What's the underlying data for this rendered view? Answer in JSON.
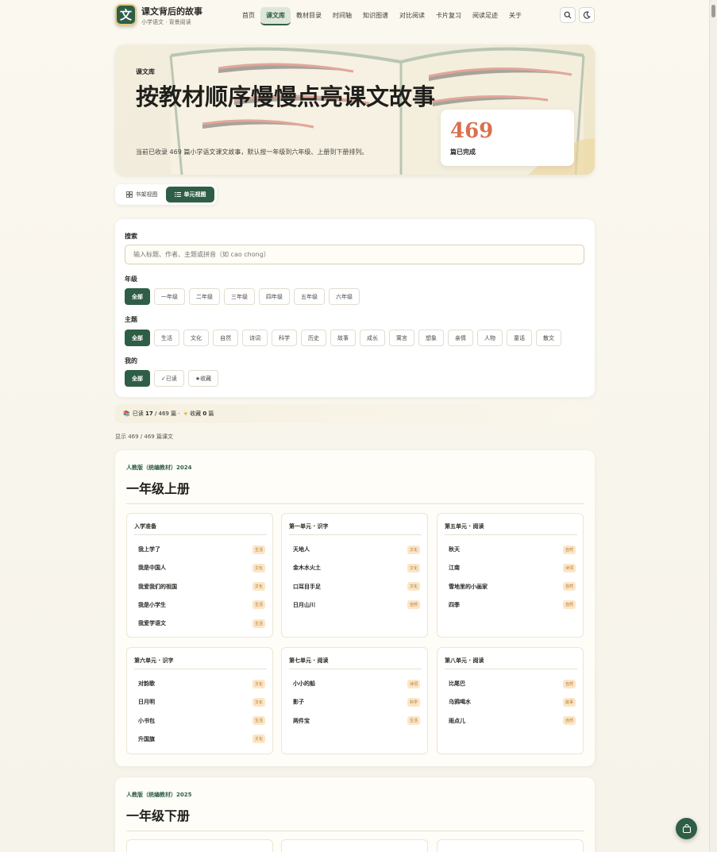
{
  "brand": {
    "logo_char": "文",
    "title": "课文背后的故事",
    "subtitle": "小学语文 · 背景阅读"
  },
  "nav": [
    "首页",
    "课文库",
    "教材目录",
    "时间轴",
    "知识图谱",
    "对比阅读",
    "卡片复习",
    "阅读足迹",
    "关于"
  ],
  "nav_active": 1,
  "hero": {
    "kicker": "课文库",
    "title": "按教材顺序慢慢点亮课文故事",
    "desc": "当前已收录 469 篇小学语文课文故事，默认按一年级到六年级、上册到下册排列。",
    "stat_value": "469",
    "stat_label": "篇已完成"
  },
  "view_toggle": {
    "shelf": "书架视图",
    "unit": "单元视图"
  },
  "filters": {
    "search_label": "搜索",
    "search_placeholder": "输入标题、作者、主题或拼音（如 cao chong）",
    "grade_label": "年级",
    "grades": [
      "全部",
      "一年级",
      "二年级",
      "三年级",
      "四年级",
      "五年级",
      "六年级"
    ],
    "theme_label": "主题",
    "themes": [
      "全部",
      "生活",
      "文化",
      "自然",
      "诗词",
      "科学",
      "历史",
      "故事",
      "成长",
      "寓言",
      "想象",
      "亲情",
      "人物",
      "童话",
      "散文"
    ],
    "mine_label": "我的",
    "mine": [
      "全部",
      "✓已读",
      "★收藏"
    ]
  },
  "status": {
    "read_prefix": "已读",
    "read_count": "17",
    "read_suffix": "/ 469 篇 ·",
    "fav_prefix": "收藏",
    "fav_count": "0",
    "fav_suffix": "篇"
  },
  "showing": "显示 469 / 469 篇课文",
  "grades_sections": [
    {
      "edition": "人教版（统编教材）2024",
      "title": "一年级上册",
      "units": [
        {
          "title": "入学准备",
          "lessons": [
            {
              "name": "我上学了",
              "tag": "生活"
            },
            {
              "name": "我是中国人",
              "tag": "文化"
            },
            {
              "name": "我爱我们的祖国",
              "tag": "文化"
            },
            {
              "name": "我是小学生",
              "tag": "生活"
            },
            {
              "name": "我爱学语文",
              "tag": "生活"
            }
          ]
        },
        {
          "title": "第一单元 · 识字",
          "lessons": [
            {
              "name": "天地人",
              "tag": "文化"
            },
            {
              "name": "金木水火土",
              "tag": "文化"
            },
            {
              "name": "口耳目手足",
              "tag": "文化"
            },
            {
              "name": "日月山川",
              "tag": "自然"
            }
          ]
        },
        {
          "title": "第五单元 · 阅读",
          "lessons": [
            {
              "name": "秋天",
              "tag": "自然"
            },
            {
              "name": "江南",
              "tag": "诗词"
            },
            {
              "name": "雪地里的小画家",
              "tag": "自然"
            },
            {
              "name": "四季",
              "tag": "自然"
            }
          ]
        },
        {
          "title": "第六单元 · 识字",
          "lessons": [
            {
              "name": "对韵歌",
              "tag": "文化"
            },
            {
              "name": "日月明",
              "tag": "文化"
            },
            {
              "name": "小书包",
              "tag": "生活"
            },
            {
              "name": "升国旗",
              "tag": "文化"
            }
          ]
        },
        {
          "title": "第七单元 · 阅读",
          "lessons": [
            {
              "name": "小小的船",
              "tag": "诗词"
            },
            {
              "name": "影子",
              "tag": "科学"
            },
            {
              "name": "两件宝",
              "tag": "生活"
            }
          ]
        },
        {
          "title": "第八单元 · 阅读",
          "lessons": [
            {
              "name": "比尾巴",
              "tag": "自然"
            },
            {
              "name": "乌鸦喝水",
              "tag": "故事"
            },
            {
              "name": "雨点儿",
              "tag": "自然"
            }
          ]
        }
      ]
    },
    {
      "edition": "人教版（统编教材）2025",
      "title": "一年级下册",
      "units": []
    }
  ]
}
